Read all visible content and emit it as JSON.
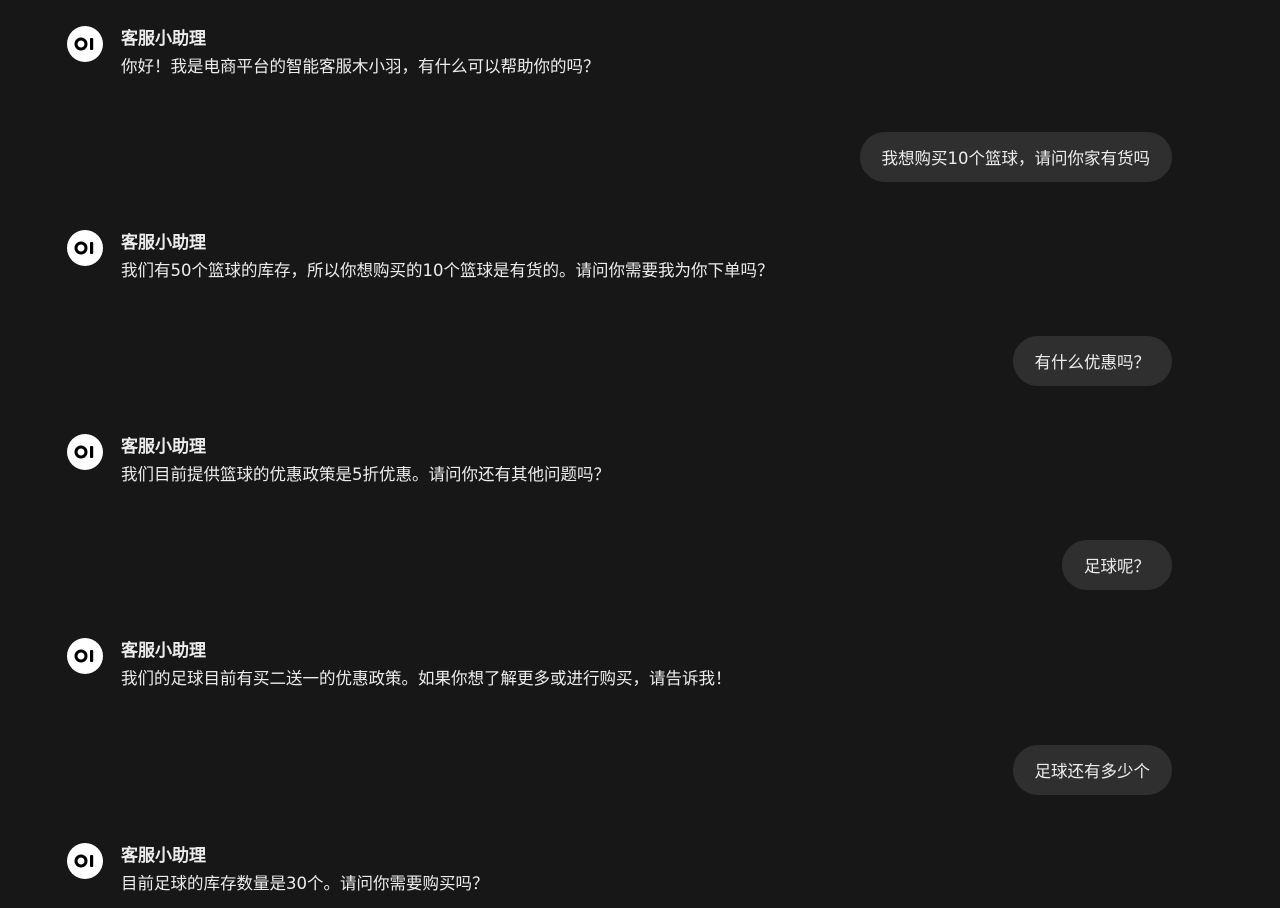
{
  "assistant": {
    "name": "客服小助理",
    "avatar_icon": "logo-icon"
  },
  "messages": [
    {
      "role": "assistant",
      "text": "你好！我是电商平台的智能客服木小羽，有什么可以帮助你的吗？"
    },
    {
      "role": "user",
      "text": "我想购买10个篮球，请问你家有货吗"
    },
    {
      "role": "assistant",
      "text": "我们有50个篮球的库存，所以你想购买的10个篮球是有货的。请问你需要我为你下单吗？"
    },
    {
      "role": "user",
      "text": "有什么优惠吗？"
    },
    {
      "role": "assistant",
      "text": "我们目前提供篮球的优惠政策是5折优惠。请问你还有其他问题吗？"
    },
    {
      "role": "user",
      "text": "足球呢？"
    },
    {
      "role": "assistant",
      "text": "我们的足球目前有买二送一的优惠政策。如果你想了解更多或进行购买，请告诉我！"
    },
    {
      "role": "user",
      "text": "足球还有多少个"
    },
    {
      "role": "assistant",
      "text": "目前足球的库存数量是30个。请问你需要购买吗？"
    }
  ],
  "colors": {
    "background": "#171717",
    "user_bubble": "#2f2f2f",
    "text": "#ececec",
    "avatar_bg": "#ffffff"
  }
}
